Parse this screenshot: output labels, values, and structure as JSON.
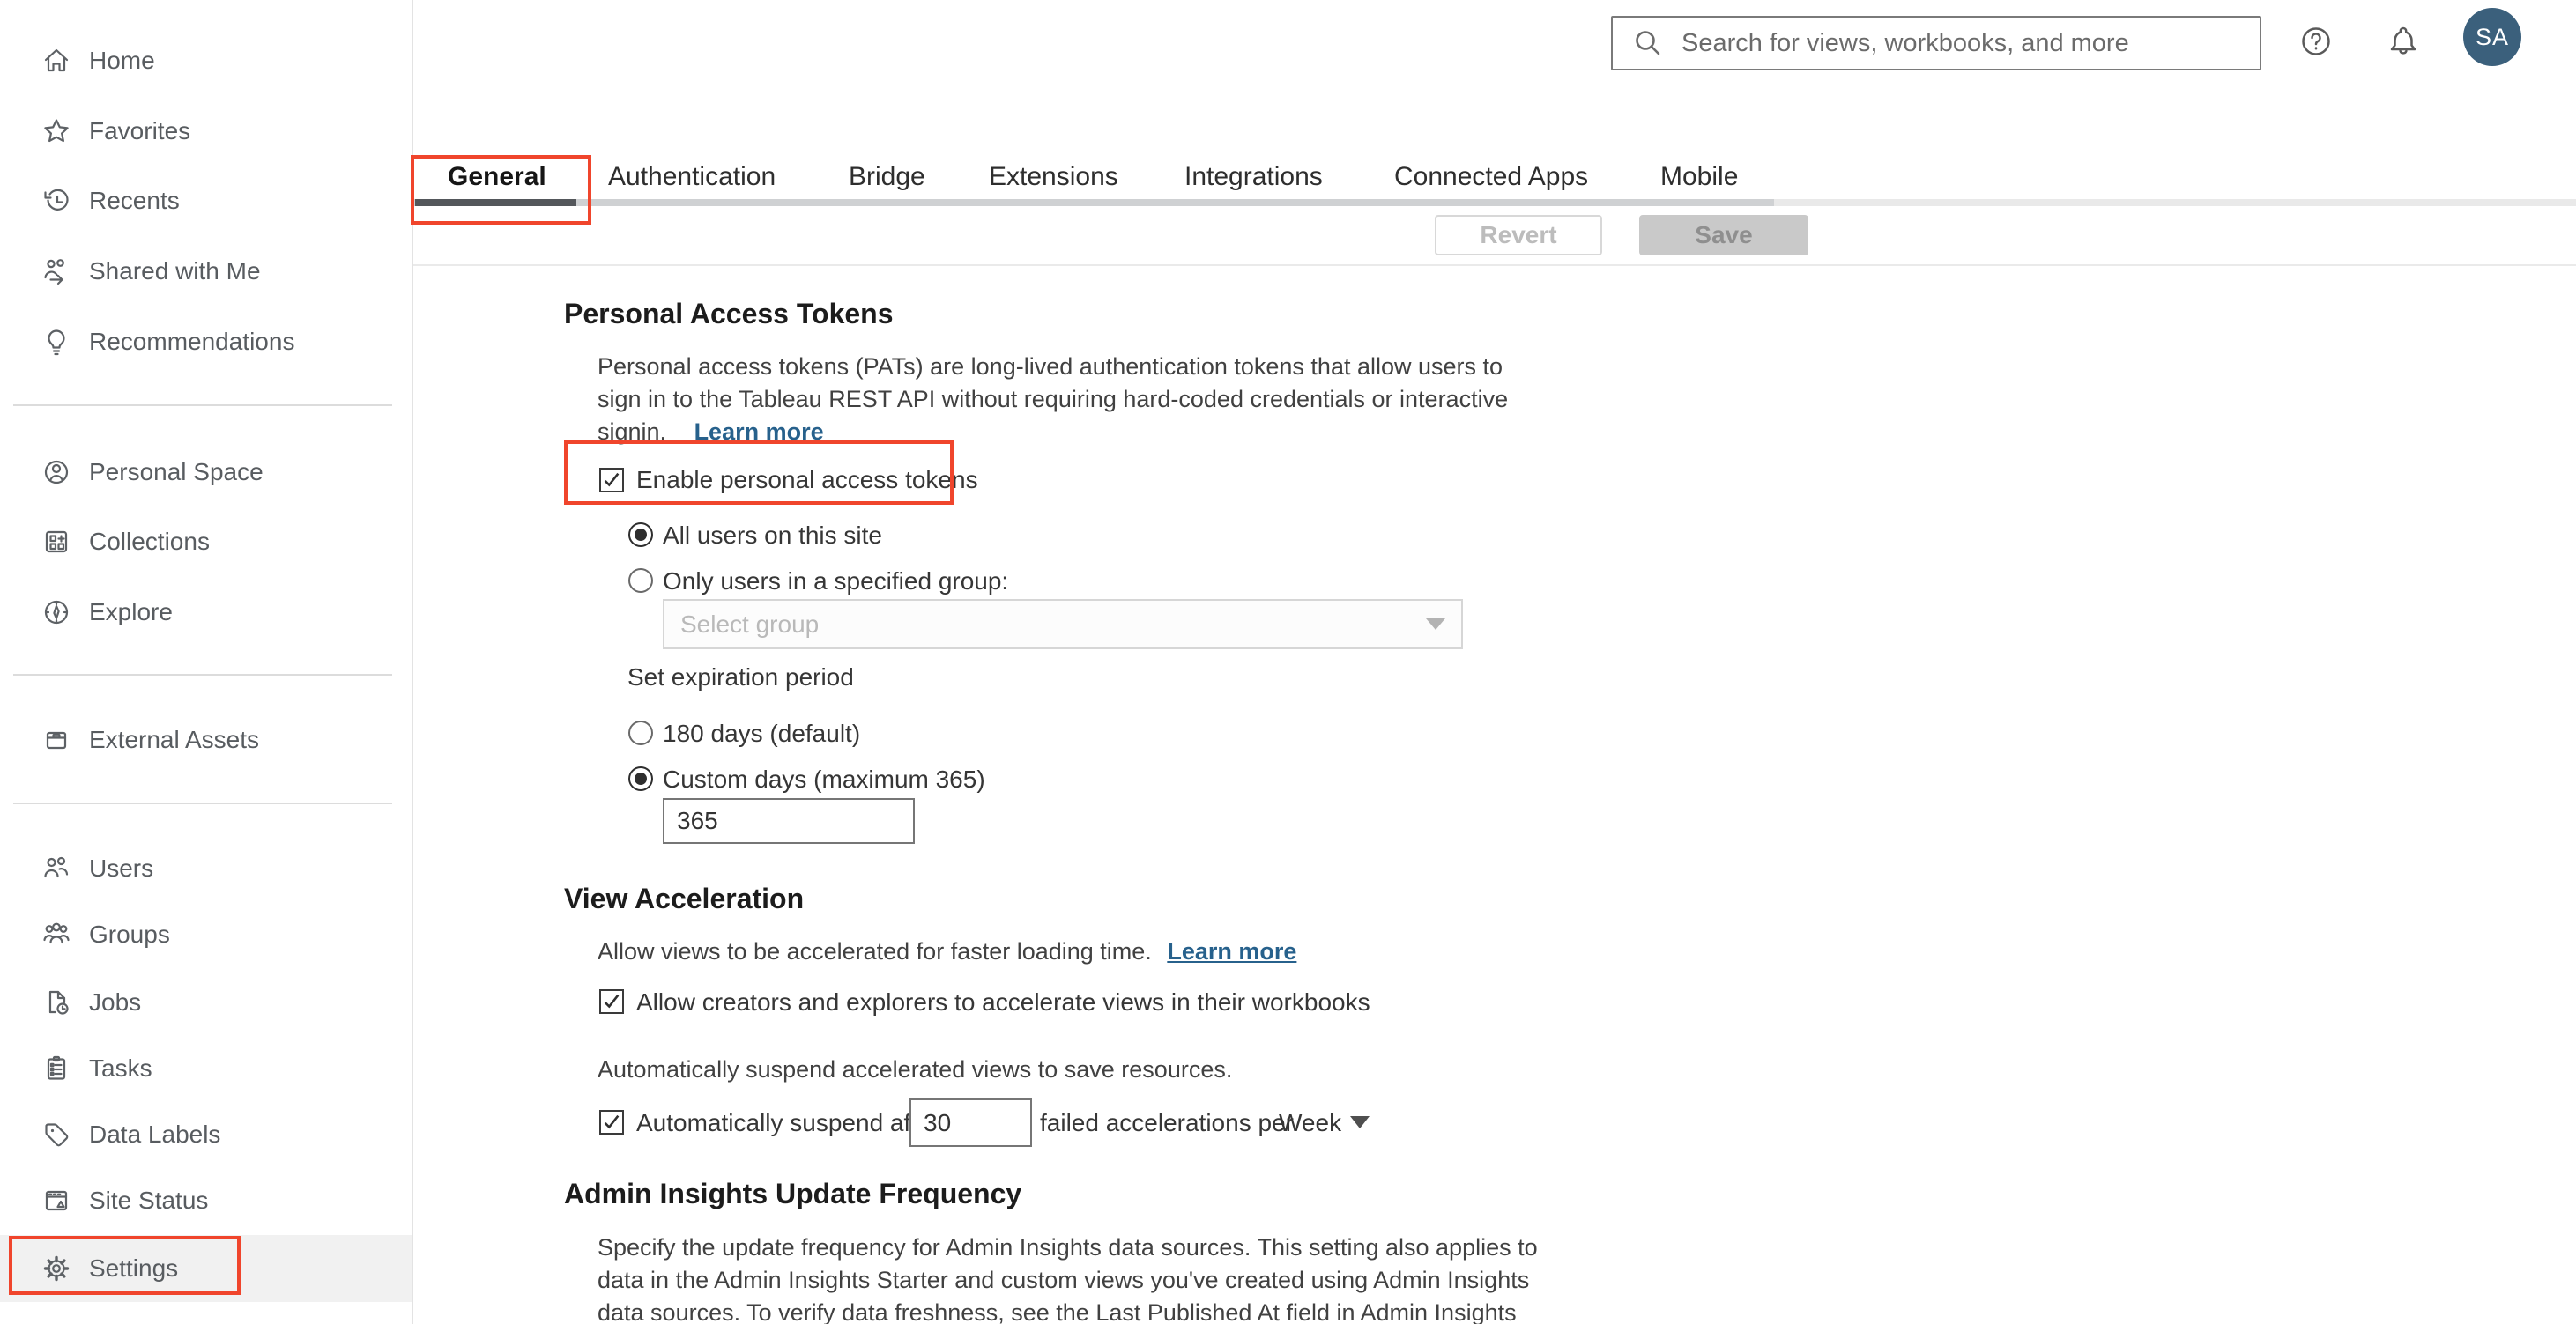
{
  "header": {
    "search_placeholder": "Search for views, workbooks, and more",
    "avatar_initials": "SA"
  },
  "sidebar": {
    "items": [
      "Home",
      "Favorites",
      "Recents",
      "Shared with Me",
      "Recommendations",
      "Personal Space",
      "Collections",
      "Explore",
      "External Assets",
      "Users",
      "Groups",
      "Jobs",
      "Tasks",
      "Data Labels",
      "Site Status",
      "Settings"
    ]
  },
  "tabs": [
    "General",
    "Authentication",
    "Bridge",
    "Extensions",
    "Integrations",
    "Connected Apps",
    "Mobile"
  ],
  "actions": {
    "revert": "Revert",
    "save": "Save"
  },
  "pat": {
    "title": "Personal Access Tokens",
    "desc_line1": "Personal access tokens (PATs) are long-lived authentication tokens that allow users to",
    "desc_line2": "sign in to the Tableau REST API without requiring hard-coded credentials or interactive",
    "desc_line3": "signin.",
    "learn_more": "Learn more",
    "enable_label": "Enable personal access tokens",
    "radio_all_users": "All users on this site",
    "radio_only_group": "Only users in a specified group:",
    "select_group_placeholder": "Select group",
    "expiration_label": "Set expiration period",
    "radio_180": "180 days (default)",
    "radio_custom": "Custom days (maximum 365)",
    "custom_days_value": "365"
  },
  "va": {
    "title": "View Acceleration",
    "desc": "Allow views to be accelerated for faster loading time.",
    "learn_more": "Learn more",
    "allow_label": "Allow creators and explorers to accelerate views in their workbooks",
    "suspend_note": "Automatically suspend accelerated views to save resources.",
    "suspend_label": "Automatically suspend after",
    "suspend_value": "30",
    "suspend_suffix": "failed accelerations per",
    "period_value": "Week"
  },
  "admin": {
    "title": "Admin Insights Update Frequency",
    "desc_line1": "Specify the update frequency for Admin Insights data sources. This setting also applies to",
    "desc_line2": "data in the Admin Insights Starter and custom views you've created using Admin Insights",
    "desc_line3": "data sources. To verify data freshness, see the Last Published At field in Admin Insights"
  },
  "colors": {
    "annotation_red": "#f0452c",
    "link_blue": "#27618c",
    "avatar_bg": "#3b607c",
    "active_tab_underline": "#54575b"
  }
}
